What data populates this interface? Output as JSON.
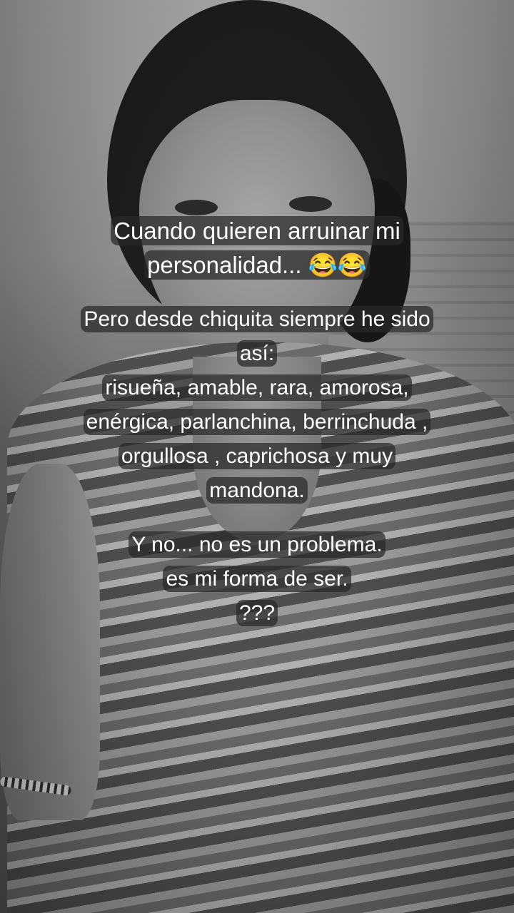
{
  "caption": {
    "lines": [
      "Cuando quieren arruinar mi",
      "personalidad... 😂😂",
      "",
      "Pero desde chiquita siempre he sido",
      "así:",
      "risueña, amable, rara, amorosa,",
      "enérgica, parlanchina,  berrinchuda ,",
      "orgullosa , caprichosa y muy",
      "mandona.",
      "",
      "Y no... no es un problema.",
      "es mi forma de ser.",
      "???"
    ]
  }
}
